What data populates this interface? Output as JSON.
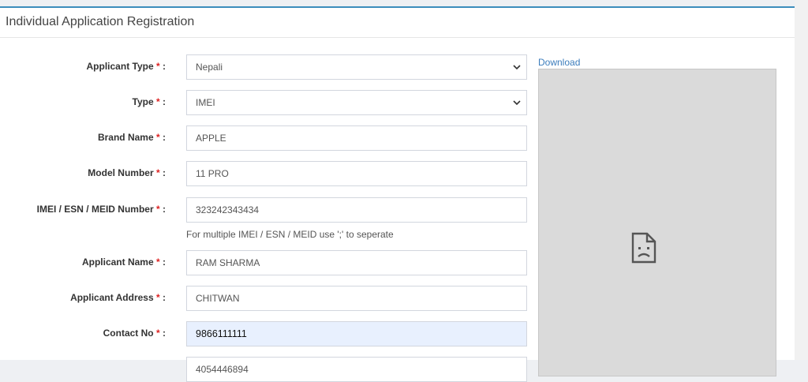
{
  "panel": {
    "title": "Individual Application Registration"
  },
  "form": {
    "applicant_type": {
      "label": "Applicant Type",
      "value": "Nepali"
    },
    "type": {
      "label": "Type",
      "value": "IMEI"
    },
    "brand_name": {
      "label": "Brand Name",
      "value": "APPLE"
    },
    "model_number": {
      "label": "Model Number",
      "value": "11 PRO"
    },
    "imei": {
      "label": "IMEI / ESN / MEID Number",
      "value": "323242343434",
      "help": "For multiple IMEI / ESN / MEID use ';' to seperate"
    },
    "applicant_name": {
      "label": "Applicant Name",
      "value": "RAM SHARMA"
    },
    "applicant_address": {
      "label": "Applicant Address",
      "value": "CHITWAN"
    },
    "contact_no": {
      "label": "Contact No",
      "value": "9866111111"
    },
    "next_field": {
      "value": "4054446894"
    },
    "required_mark": "*",
    "colon": ":"
  },
  "side": {
    "download_label": "Download",
    "preview_icon": "broken-document-icon"
  },
  "colors": {
    "accent": "#3c8dbc",
    "required": "#dd2222",
    "filled_bg": "#e8f0fe",
    "preview_bg": "#dadada"
  }
}
